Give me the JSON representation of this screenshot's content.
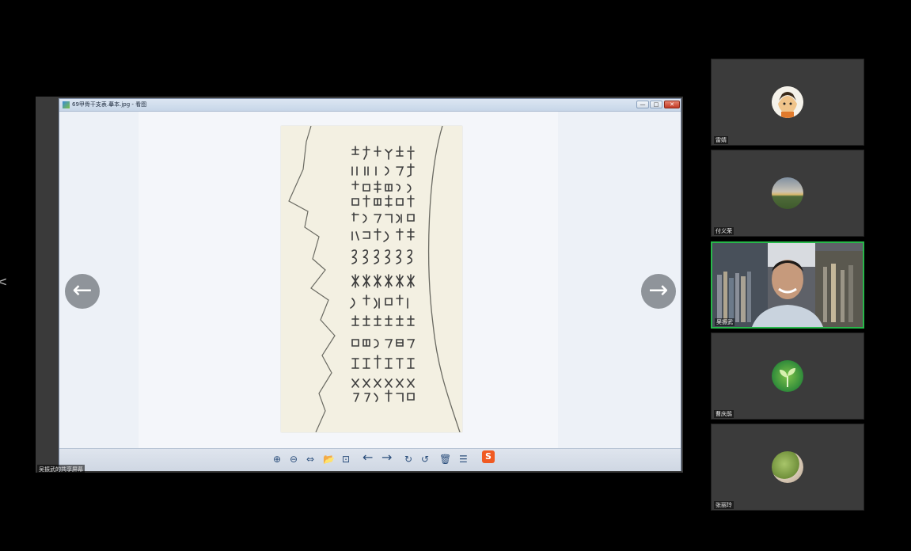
{
  "window": {
    "title": "69甲骨干支表.摹本.jpg - 看图",
    "minimize_label": "—",
    "maximize_label": "□",
    "close_label": "✕"
  },
  "share_label": "吴振武的共享屏幕",
  "viewer": {
    "prev_label": "←",
    "next_label": "→"
  },
  "toolbar": {
    "zoom_in": "⊕",
    "zoom_out": "⊖",
    "fit": "⇔",
    "open": "📂",
    "slideshow": "⊡",
    "prev": "←",
    "next": "→",
    "rotate_right": "↻",
    "rotate_left": "↺",
    "delete": "🗑",
    "menu": "☰",
    "ime_logo": "S"
  },
  "participants": [
    {
      "name": "雷婧"
    },
    {
      "name": "付义荣"
    },
    {
      "name": "吴振武",
      "active": true
    },
    {
      "name": "曹庆鹃"
    },
    {
      "name": "张丽玲"
    }
  ],
  "colors": {
    "active_border": "#27b84a",
    "share_frame": "#3a3a3a",
    "tile_bg": "#3b3b3b"
  }
}
